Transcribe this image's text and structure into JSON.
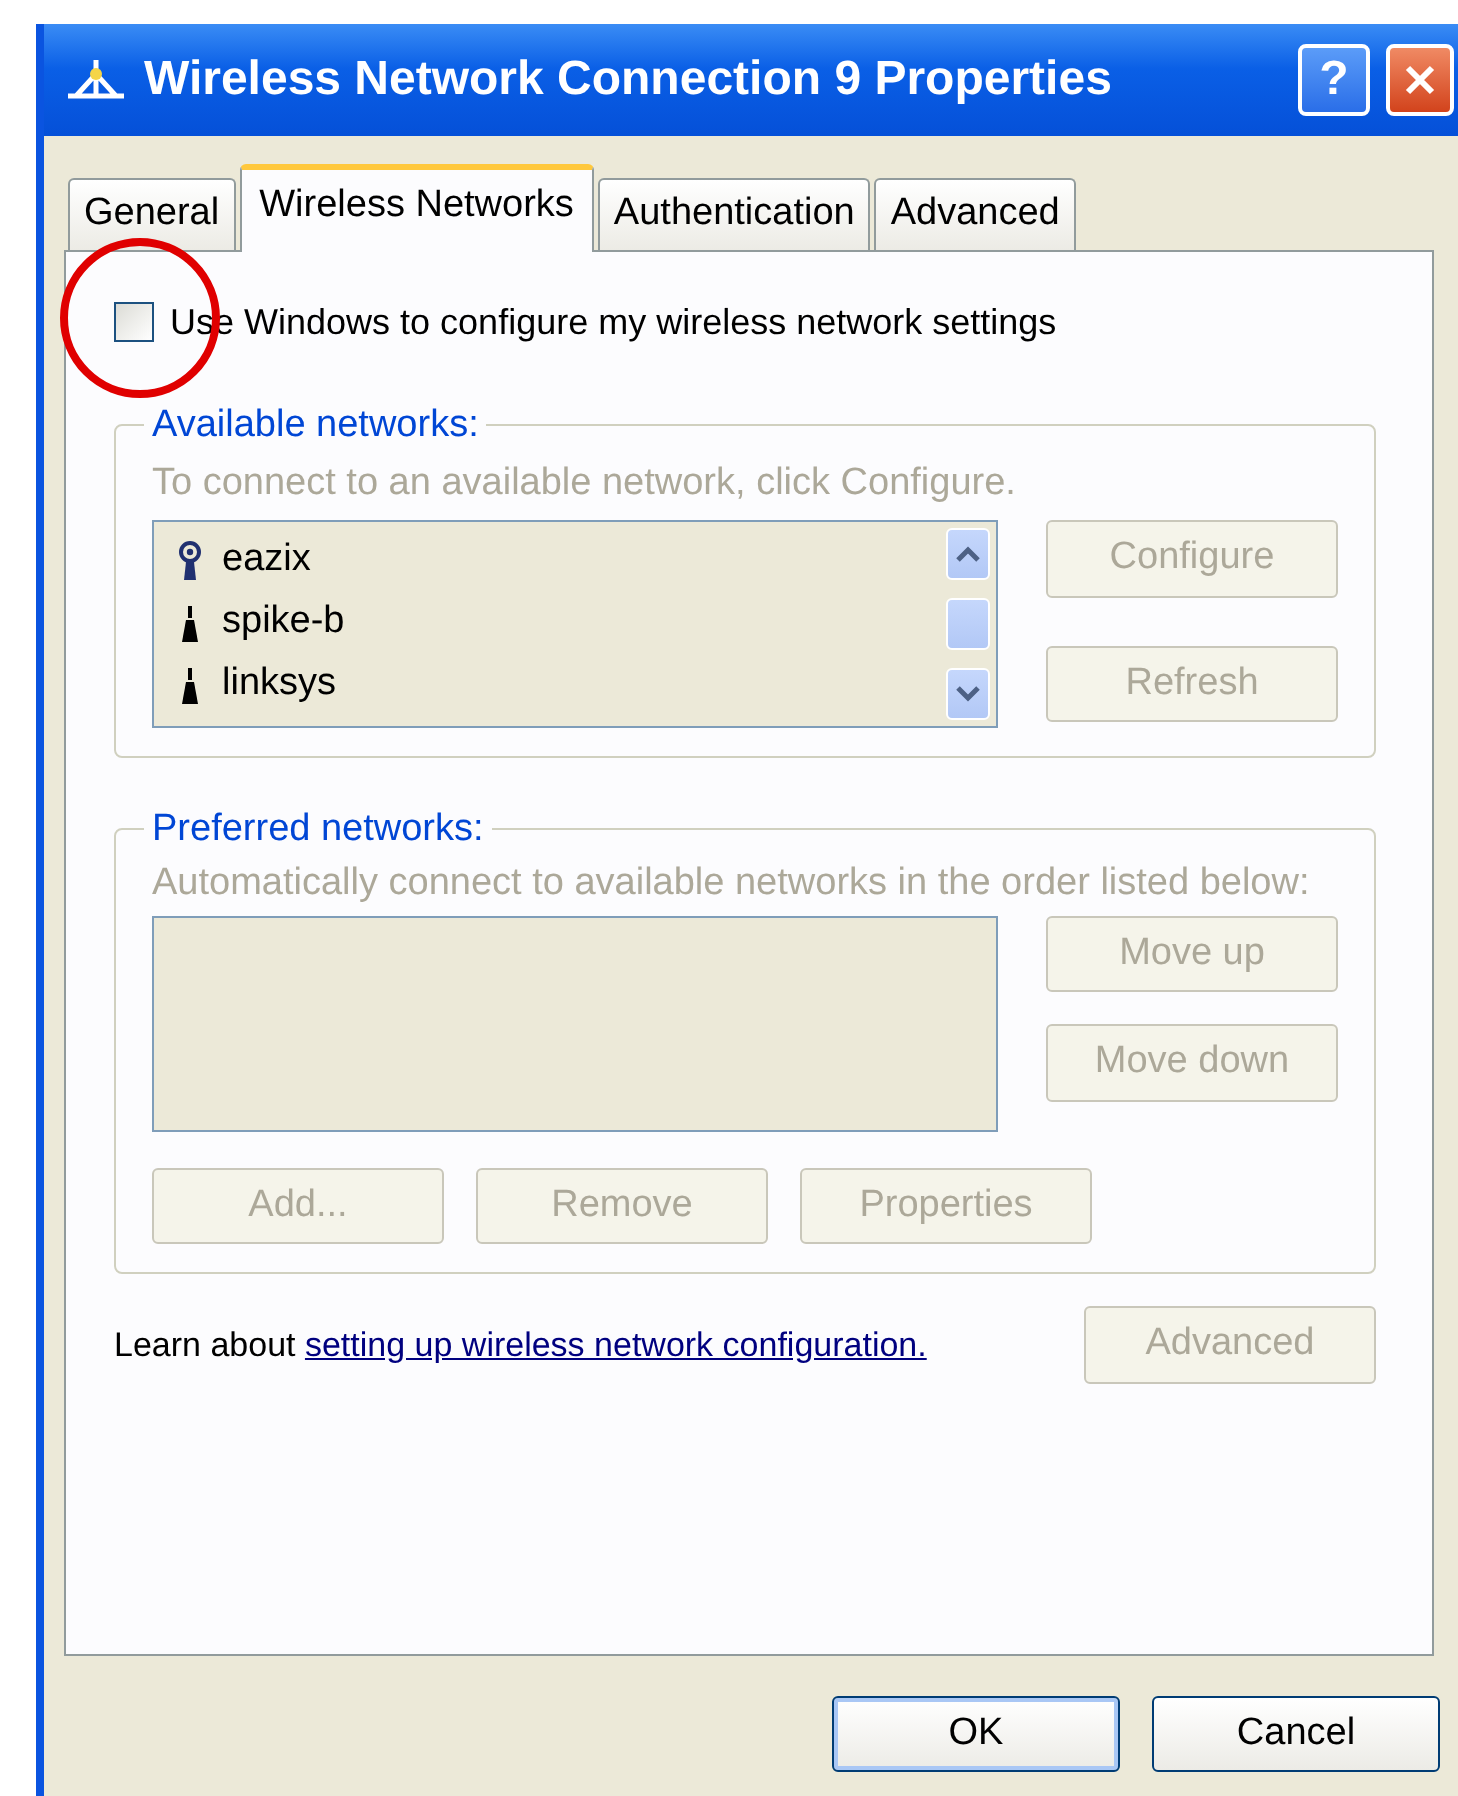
{
  "window": {
    "title": "Wireless Network Connection 9 Properties",
    "help_glyph": "?"
  },
  "tabs": [
    {
      "label": "General",
      "selected": false
    },
    {
      "label": "Wireless Networks",
      "selected": true
    },
    {
      "label": "Authentication",
      "selected": false
    },
    {
      "label": "Advanced",
      "selected": false
    }
  ],
  "use_windows": {
    "label": "Use Windows to configure my wireless network settings",
    "checked": false,
    "circled": true
  },
  "available": {
    "title": "Available networks:",
    "hint": "To connect to an available network, click Configure.",
    "networks": [
      {
        "name": "eazix",
        "kind": "beacon"
      },
      {
        "name": "spike-b",
        "kind": "antenna"
      },
      {
        "name": "linksys",
        "kind": "antenna"
      }
    ],
    "buttons": [
      {
        "label": "Configure",
        "disabled": true
      },
      {
        "label": "Refresh",
        "disabled": true
      }
    ]
  },
  "preferred": {
    "title": "Preferred networks:",
    "hint": "Automatically connect to available networks in the order listed below:",
    "side_buttons": [
      {
        "label": "Move up",
        "disabled": true
      },
      {
        "label": "Move down",
        "disabled": true
      }
    ],
    "bottom_buttons": [
      {
        "label": "Add...",
        "disabled": true
      },
      {
        "label": "Remove",
        "disabled": true
      },
      {
        "label": "Properties",
        "disabled": true
      }
    ]
  },
  "learn": {
    "text": "Learn about",
    "link": "setting up wireless network configuration."
  },
  "advanced_button": {
    "label": "Advanced",
    "disabled": true
  },
  "dialog_buttons": [
    {
      "label": "OK",
      "disabled": false,
      "default": true
    },
    {
      "label": "Cancel",
      "disabled": false,
      "default": false
    }
  ]
}
